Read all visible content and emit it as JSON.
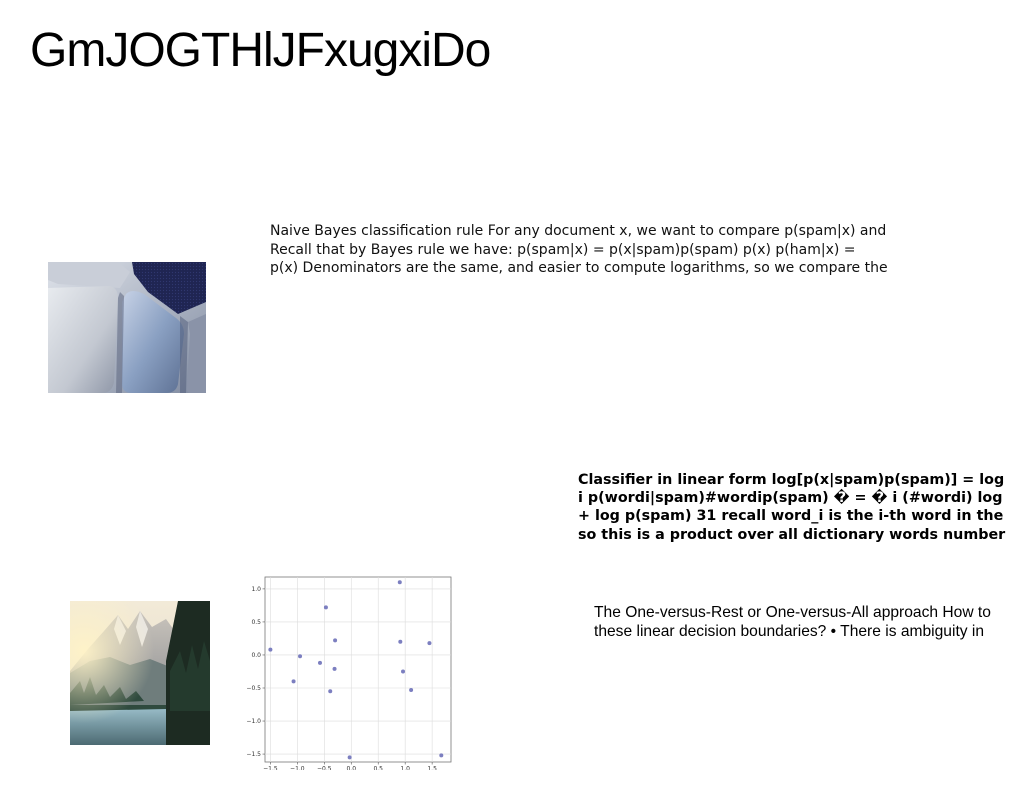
{
  "title": "GmJOGTHlJFxugxiDo",
  "block1": {
    "lines": [
      "Naive Bayes classification rule For any document x, we want to compare p(spam|x) and",
      "Recall that by Bayes rule we have: p(spam|x) = p(x|spam)p(spam) p(x) p(ham|x) =",
      "p(x) Denominators are the same, and easier to compute logarithms, so we compare the"
    ]
  },
  "block2": {
    "lines": [
      "Classifier in linear form log[p(x|spam)p(spam)] = log",
      "i p(wordi|spam)#wordip(spam) � = � i (#wordi) log",
      "+ log p(spam) 31 recall word_i is the i-th word in the",
      "so this is a product over all dictionary words number"
    ]
  },
  "block3": {
    "lines": [
      "The One-versus-Rest or One-versus-All approach How to",
      "these linear decision boundaries? • There is ambiguity in"
    ]
  },
  "chart_data": {
    "type": "scatter",
    "title": "",
    "xlabel": "",
    "ylabel": "",
    "xlim": [
      -1.6,
      1.85
    ],
    "ylim": [
      -1.62,
      1.18
    ],
    "xticks": [
      -1.5,
      -1.0,
      -0.5,
      0.0,
      0.5,
      1.0,
      1.5
    ],
    "xtick_labels": [
      "−1.5",
      "−1.0",
      "−0.5",
      "0.0",
      "0.5",
      "1.0",
      "1.5"
    ],
    "yticks": [
      1.0,
      0.5,
      0.0,
      -0.5,
      -1.0,
      -1.5
    ],
    "ytick_labels": [
      "1.0",
      "0.5",
      "0.0",
      "−0.5",
      "−1.0",
      "−1.5"
    ],
    "grid": true,
    "point_color": "#7c7fc0",
    "x": [
      -1.5,
      -1.07,
      -0.95,
      -0.58,
      -0.47,
      -0.39,
      -0.3,
      -0.31,
      -0.03,
      0.9,
      0.91,
      0.96,
      1.11,
      1.45,
      1.67
    ],
    "y": [
      0.08,
      -0.4,
      -0.02,
      -0.12,
      0.72,
      -0.55,
      0.22,
      -0.21,
      -1.55,
      1.1,
      0.2,
      -0.25,
      -0.53,
      0.18,
      -1.52
    ]
  }
}
